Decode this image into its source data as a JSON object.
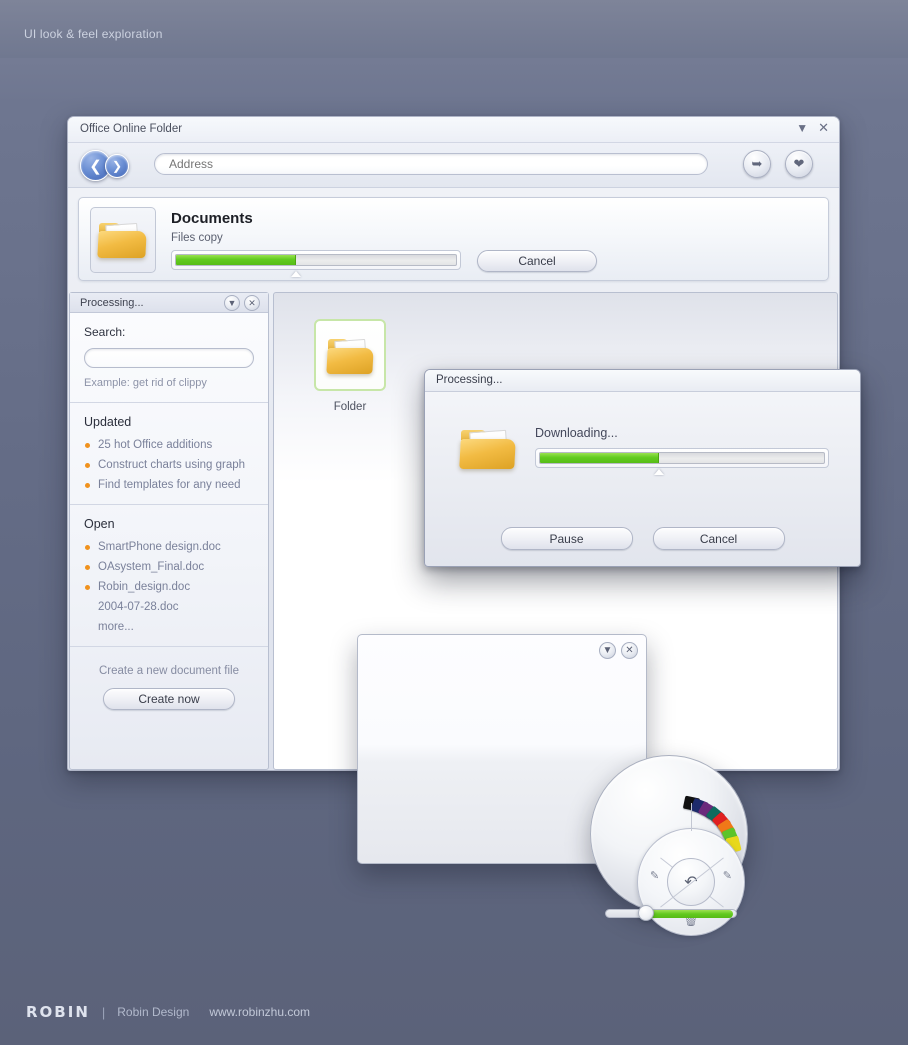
{
  "page": {
    "header_title": "UI look & feel exploration"
  },
  "footer": {
    "logo": "ROBIN",
    "separator": "|",
    "studio": "Robin Design",
    "url": "www.robinzhu.com"
  },
  "window": {
    "title": "Office Online Folder",
    "controls": {
      "menu_icon": "chevron-down-icon",
      "close_icon": "close-icon"
    },
    "toolbar": {
      "back_icon": "back-arrow-icon",
      "forward_icon": "forward-arrow-icon",
      "address_placeholder": "Address",
      "address_value": "",
      "go_icon": "go-arrow-icon",
      "favorite_icon": "heart-icon"
    },
    "banner": {
      "folder_icon": "folder-icon",
      "title": "Documents",
      "subtitle": "Files copy",
      "progress_percent": 43,
      "cancel_label": "Cancel"
    }
  },
  "sidebar": {
    "header_title": "Processing...",
    "collapse_icon": "chevron-down-icon",
    "close_icon": "close-icon",
    "search": {
      "label": "Search:",
      "value": "",
      "placeholder": "",
      "hint": "Example: get rid of clippy"
    },
    "updated": {
      "title": "Updated",
      "items": [
        {
          "label": "25 hot Office additions",
          "bulleted": true
        },
        {
          "label": "Construct charts using graph",
          "bulleted": true
        },
        {
          "label": "Find templates for any need",
          "bulleted": true
        }
      ]
    },
    "open": {
      "title": "Open",
      "items": [
        {
          "label": "SmartPhone design.doc",
          "bulleted": true
        },
        {
          "label": "OAsystem_Final.doc",
          "bulleted": true
        },
        {
          "label": "Robin_design.doc",
          "bulleted": true
        },
        {
          "label": "2004-07-28.doc",
          "bulleted": false
        },
        {
          "label": "more...",
          "bulleted": false
        }
      ]
    },
    "create": {
      "text": "Create a new document file",
      "button_label": "Create now"
    }
  },
  "content": {
    "files": [
      {
        "label": "Folder",
        "icon": "folder-icon",
        "selected": true
      }
    ]
  },
  "dialog": {
    "title": "Processing...",
    "folder_icon": "folder-icon",
    "message": "Downloading...",
    "progress_percent": 42,
    "pause_label": "Pause",
    "cancel_label": "Cancel"
  },
  "blank_panel": {
    "collapse_icon": "chevron-down-icon",
    "close_icon": "close-icon"
  },
  "device": {
    "center_icon": "undo-arrow-icon",
    "left_icon": "tag-icon",
    "right_icon": "tag-icon",
    "bottom_icon": "trash-icon",
    "palette_colors": [
      "#111111",
      "#1d2a6b",
      "#6b2a7c",
      "#0f6b5e",
      "#e02020",
      "#f07818",
      "#5cc42a",
      "#e8d81c"
    ],
    "slider_percent": 30
  },
  "colors": {
    "accent_green": "#62cb20",
    "accent_orange": "#f0921e",
    "desktop_blue": "#646c86",
    "link_gray": "#7a819a"
  }
}
